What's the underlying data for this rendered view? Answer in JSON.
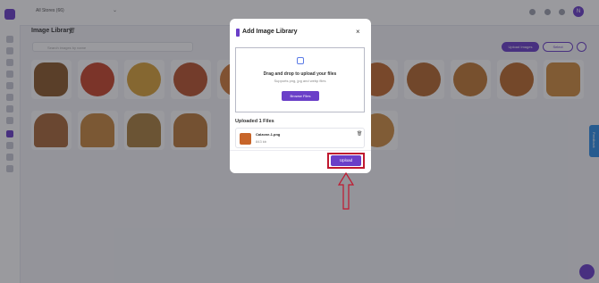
{
  "header": {
    "store_selector": "All Stores (66)",
    "avatar_initial": "N"
  },
  "page": {
    "title": "Image Library",
    "search_placeholder": "Search images by name",
    "upload_button": "Upload Images",
    "select_button": "Select"
  },
  "feedback_tab": "Feedback",
  "modal": {
    "title": "Add Image Library",
    "close": "×",
    "dropzone": {
      "heading": "Drag and drop to upload your files",
      "subtext": "Supports png, jpg and webp files",
      "browse_button": "Browse Files"
    },
    "uploaded_label": "Uploaded 1 Files",
    "files": [
      {
        "name": "Calzone-1.png",
        "size": "843 kb"
      }
    ],
    "upload_button": "Upload"
  },
  "colors": {
    "accent": "#6a3fc8",
    "highlight": "#c0182f",
    "feedback": "#2f8de4"
  }
}
